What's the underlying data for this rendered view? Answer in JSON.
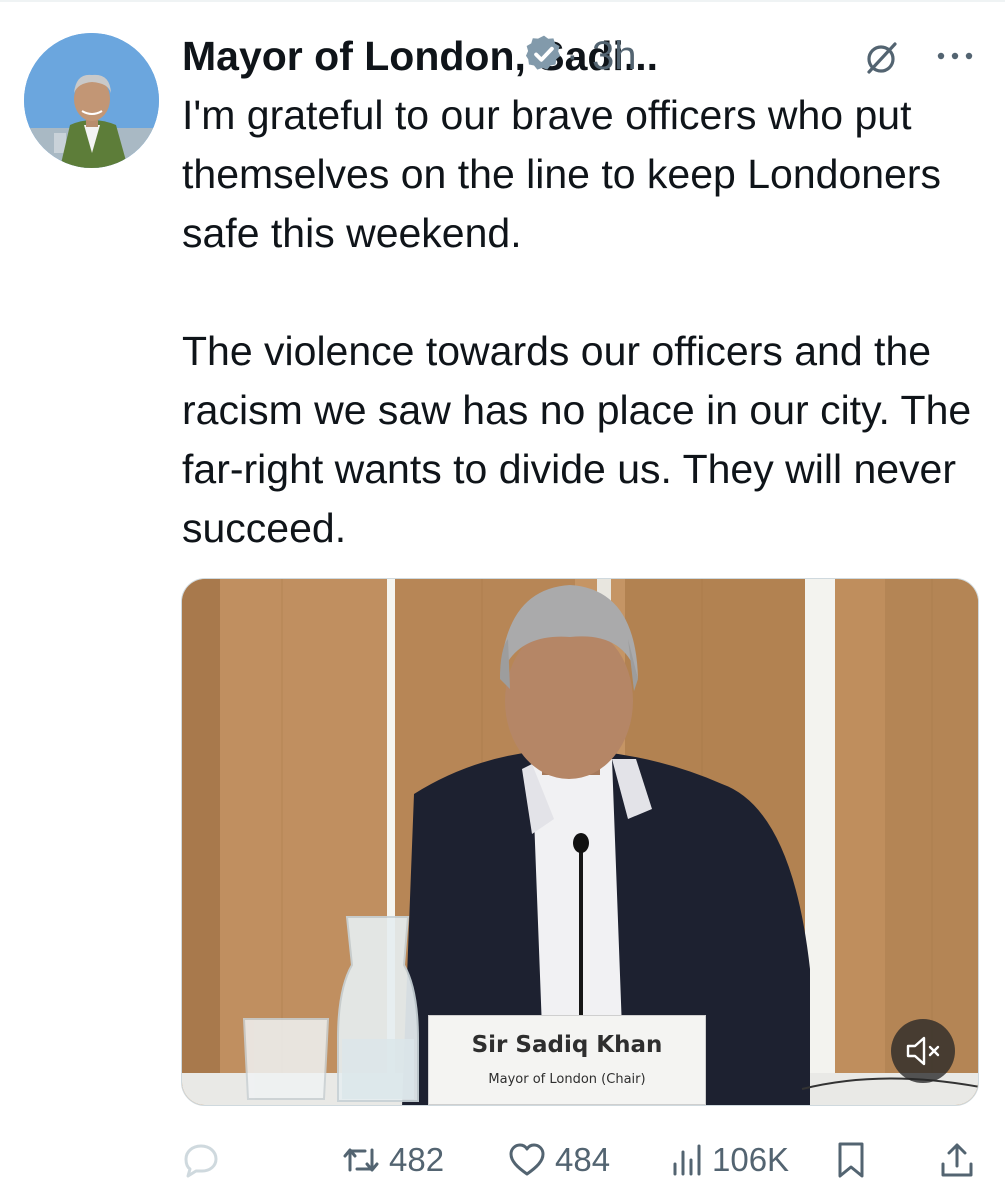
{
  "author": {
    "display_name": "Mayor of London, Sadi...",
    "verified_icon": "verified-badge-icon",
    "separator": "·",
    "time": "3h"
  },
  "tweet": {
    "text": "I'm grateful to our brave officers who put themselves on the line to keep Londoners safe this weekend.\n\nThe violence towards our officers and the racism we saw has no place in our city. The far-right wants to divide us. They will never succeed."
  },
  "media": {
    "nameplate_name": "Sir Sadiq Khan",
    "nameplate_role": "Mayor of London (Chair)",
    "mute_icon": "speaker-muted-icon"
  },
  "actions": {
    "reply_icon": "reply-icon",
    "retweets": "482",
    "likes": "484",
    "views": "106K",
    "bookmark_icon": "bookmark-icon",
    "share_icon": "share-icon"
  },
  "colors": {
    "text_primary": "#0f1419",
    "text_secondary": "#536471",
    "verified_badge": "#829aab",
    "reply_icon": "#cfd9de"
  }
}
